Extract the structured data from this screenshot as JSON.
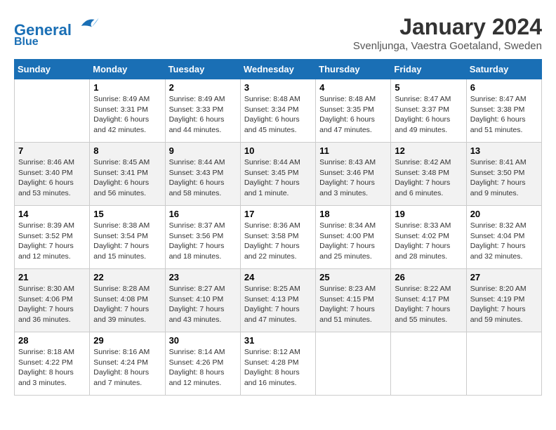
{
  "header": {
    "logo_line1": "General",
    "logo_line2": "Blue",
    "month": "January 2024",
    "location": "Svenljunga, Vaestra Goetaland, Sweden"
  },
  "weekdays": [
    "Sunday",
    "Monday",
    "Tuesday",
    "Wednesday",
    "Thursday",
    "Friday",
    "Saturday"
  ],
  "weeks": [
    [
      {
        "day": "",
        "info": ""
      },
      {
        "day": "1",
        "info": "Sunrise: 8:49 AM\nSunset: 3:31 PM\nDaylight: 6 hours\nand 42 minutes."
      },
      {
        "day": "2",
        "info": "Sunrise: 8:49 AM\nSunset: 3:33 PM\nDaylight: 6 hours\nand 44 minutes."
      },
      {
        "day": "3",
        "info": "Sunrise: 8:48 AM\nSunset: 3:34 PM\nDaylight: 6 hours\nand 45 minutes."
      },
      {
        "day": "4",
        "info": "Sunrise: 8:48 AM\nSunset: 3:35 PM\nDaylight: 6 hours\nand 47 minutes."
      },
      {
        "day": "5",
        "info": "Sunrise: 8:47 AM\nSunset: 3:37 PM\nDaylight: 6 hours\nand 49 minutes."
      },
      {
        "day": "6",
        "info": "Sunrise: 8:47 AM\nSunset: 3:38 PM\nDaylight: 6 hours\nand 51 minutes."
      }
    ],
    [
      {
        "day": "7",
        "info": "Sunrise: 8:46 AM\nSunset: 3:40 PM\nDaylight: 6 hours\nand 53 minutes."
      },
      {
        "day": "8",
        "info": "Sunrise: 8:45 AM\nSunset: 3:41 PM\nDaylight: 6 hours\nand 56 minutes."
      },
      {
        "day": "9",
        "info": "Sunrise: 8:44 AM\nSunset: 3:43 PM\nDaylight: 6 hours\nand 58 minutes."
      },
      {
        "day": "10",
        "info": "Sunrise: 8:44 AM\nSunset: 3:45 PM\nDaylight: 7 hours\nand 1 minute."
      },
      {
        "day": "11",
        "info": "Sunrise: 8:43 AM\nSunset: 3:46 PM\nDaylight: 7 hours\nand 3 minutes."
      },
      {
        "day": "12",
        "info": "Sunrise: 8:42 AM\nSunset: 3:48 PM\nDaylight: 7 hours\nand 6 minutes."
      },
      {
        "day": "13",
        "info": "Sunrise: 8:41 AM\nSunset: 3:50 PM\nDaylight: 7 hours\nand 9 minutes."
      }
    ],
    [
      {
        "day": "14",
        "info": "Sunrise: 8:39 AM\nSunset: 3:52 PM\nDaylight: 7 hours\nand 12 minutes."
      },
      {
        "day": "15",
        "info": "Sunrise: 8:38 AM\nSunset: 3:54 PM\nDaylight: 7 hours\nand 15 minutes."
      },
      {
        "day": "16",
        "info": "Sunrise: 8:37 AM\nSunset: 3:56 PM\nDaylight: 7 hours\nand 18 minutes."
      },
      {
        "day": "17",
        "info": "Sunrise: 8:36 AM\nSunset: 3:58 PM\nDaylight: 7 hours\nand 22 minutes."
      },
      {
        "day": "18",
        "info": "Sunrise: 8:34 AM\nSunset: 4:00 PM\nDaylight: 7 hours\nand 25 minutes."
      },
      {
        "day": "19",
        "info": "Sunrise: 8:33 AM\nSunset: 4:02 PM\nDaylight: 7 hours\nand 28 minutes."
      },
      {
        "day": "20",
        "info": "Sunrise: 8:32 AM\nSunset: 4:04 PM\nDaylight: 7 hours\nand 32 minutes."
      }
    ],
    [
      {
        "day": "21",
        "info": "Sunrise: 8:30 AM\nSunset: 4:06 PM\nDaylight: 7 hours\nand 36 minutes."
      },
      {
        "day": "22",
        "info": "Sunrise: 8:28 AM\nSunset: 4:08 PM\nDaylight: 7 hours\nand 39 minutes."
      },
      {
        "day": "23",
        "info": "Sunrise: 8:27 AM\nSunset: 4:10 PM\nDaylight: 7 hours\nand 43 minutes."
      },
      {
        "day": "24",
        "info": "Sunrise: 8:25 AM\nSunset: 4:13 PM\nDaylight: 7 hours\nand 47 minutes."
      },
      {
        "day": "25",
        "info": "Sunrise: 8:23 AM\nSunset: 4:15 PM\nDaylight: 7 hours\nand 51 minutes."
      },
      {
        "day": "26",
        "info": "Sunrise: 8:22 AM\nSunset: 4:17 PM\nDaylight: 7 hours\nand 55 minutes."
      },
      {
        "day": "27",
        "info": "Sunrise: 8:20 AM\nSunset: 4:19 PM\nDaylight: 7 hours\nand 59 minutes."
      }
    ],
    [
      {
        "day": "28",
        "info": "Sunrise: 8:18 AM\nSunset: 4:22 PM\nDaylight: 8 hours\nand 3 minutes."
      },
      {
        "day": "29",
        "info": "Sunrise: 8:16 AM\nSunset: 4:24 PM\nDaylight: 8 hours\nand 7 minutes."
      },
      {
        "day": "30",
        "info": "Sunrise: 8:14 AM\nSunset: 4:26 PM\nDaylight: 8 hours\nand 12 minutes."
      },
      {
        "day": "31",
        "info": "Sunrise: 8:12 AM\nSunset: 4:28 PM\nDaylight: 8 hours\nand 16 minutes."
      },
      {
        "day": "",
        "info": ""
      },
      {
        "day": "",
        "info": ""
      },
      {
        "day": "",
        "info": ""
      }
    ]
  ]
}
